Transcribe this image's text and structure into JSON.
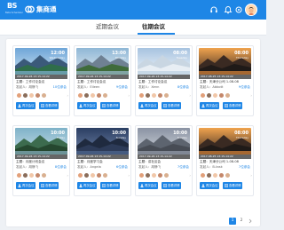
{
  "app": {
    "brand_mark": "BS",
    "brand_sub": "Beta Scheduler",
    "name": "集商通"
  },
  "tabs": [
    {
      "label": "近期会议",
      "active": false
    },
    {
      "label": "往期会议",
      "active": true
    }
  ],
  "action_labels": {
    "invite": "再次会议",
    "view": "查看详情"
  },
  "meetings": [
    {
      "time": "12:00",
      "day": "Wednesday",
      "datetime": "2017-09-26 13:15-14:22",
      "subject": "主题：工作讨论会议",
      "sponsor": "发起人：胡静飞",
      "count": "10位参会",
      "scene": "lake"
    },
    {
      "time": "13:00",
      "day": "Monday",
      "datetime": "2017-09-26 13:15-14:22",
      "subject": "主题：工作讨论会议",
      "sponsor": "发起人：Eileen",
      "count": "9位参会",
      "scene": "mountain"
    },
    {
      "time": "08:00",
      "day": "Tuesday",
      "datetime": "2017-09-26 13:15-14:22",
      "subject": "主题：工作讨论会议",
      "sponsor": "发起人：Xenn",
      "count": "8位参会",
      "scene": "snow"
    },
    {
      "time": "08:00",
      "day": "Thursday",
      "datetime": "2017-08-25 13:15-14:22",
      "subject": "主题：天津分公司 1-08-08",
      "sponsor": "发起人：Abbott",
      "count": "9位参会",
      "scene": "sunset"
    },
    {
      "time": "10:00",
      "day": "Friday",
      "datetime": "2017-09-26 13:15-14:22",
      "subject": "主题：月度计划会议",
      "sponsor": "发起人：胡静飞",
      "count": "8位参会",
      "scene": "forest"
    },
    {
      "time": "10:00",
      "day": "Sunday",
      "datetime": "2017-09-26 13:15-14:22",
      "subject": "主题：月度学习会",
      "sponsor": "发起人：Angela",
      "count": "6位参会",
      "scene": "dusk"
    },
    {
      "time": "10:00",
      "day": "Sunday",
      "datetime": "2017-09-26 13:15-14:22",
      "subject": "主题：讲社区会",
      "sponsor": "发起人：胡静飞",
      "count": "7位参会",
      "scene": "pier"
    },
    {
      "time": "08:00",
      "day": "Thursday",
      "datetime": "2017-08-25 13:15-14:22",
      "subject": "主题：天津分公司 1-08-08",
      "sponsor": "发起人：B-task",
      "count": "7位参会",
      "scene": "sunset"
    }
  ],
  "pagination": {
    "pages": [
      "1",
      "2"
    ],
    "current": "1"
  },
  "colors": {
    "primary": "#1e86e6",
    "background": "#eef1f5"
  }
}
